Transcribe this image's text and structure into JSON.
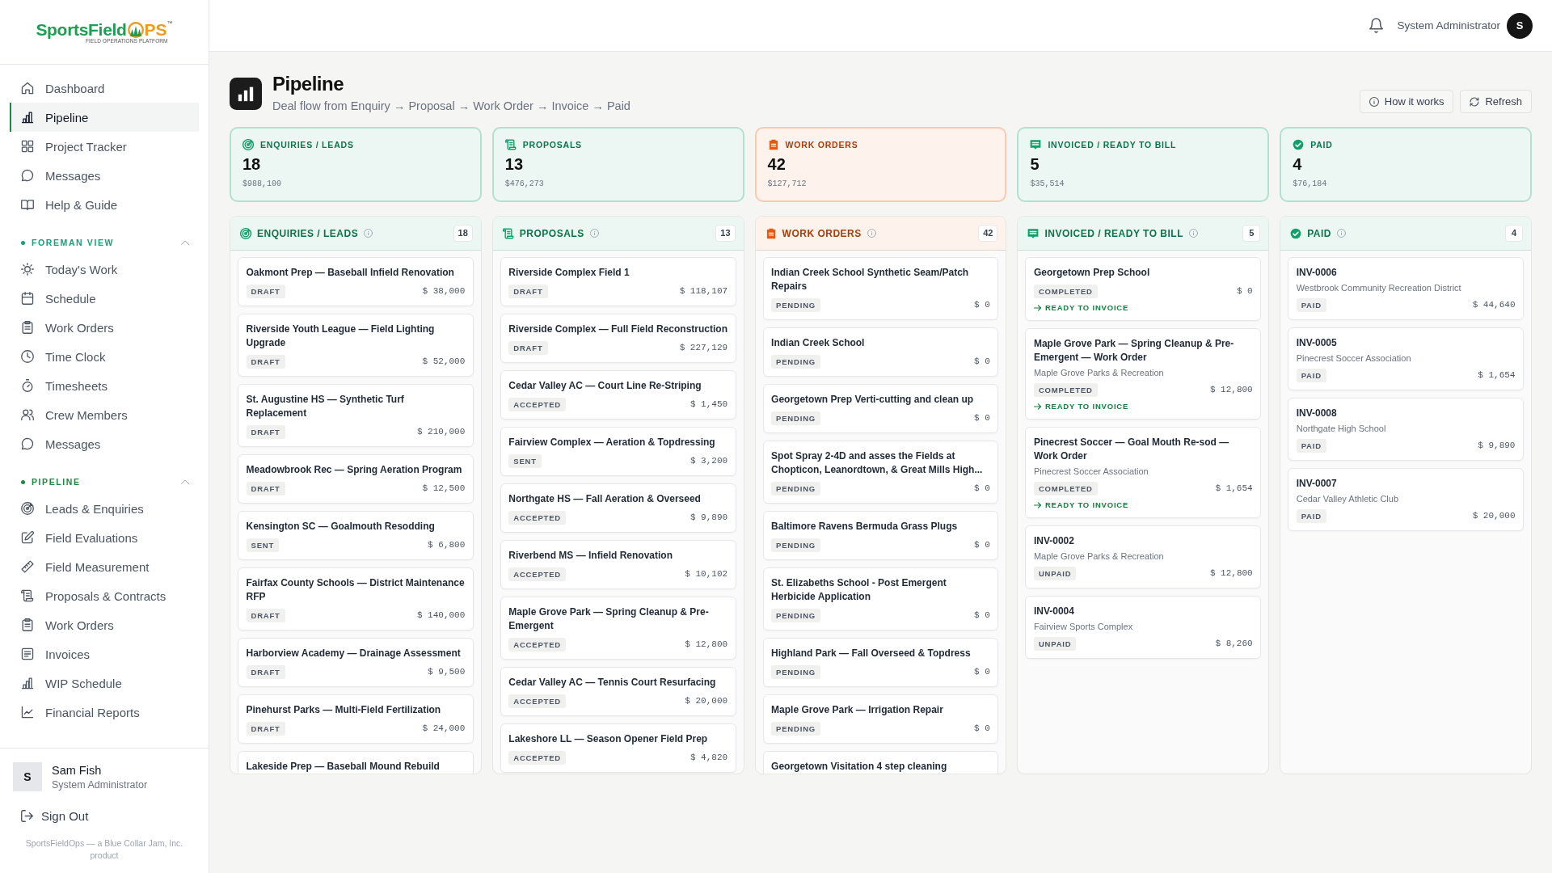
{
  "sidebar": {
    "logo": {
      "wordmark_start": "SportsField",
      "wordmark_end": "PS",
      "trademark": "™",
      "tagline": "FIELD OPERATIONS PLATFORM"
    },
    "nav": [
      {
        "label": "Dashboard",
        "selected": false
      },
      {
        "label": "Pipeline",
        "selected": true
      },
      {
        "label": "Project Tracker",
        "selected": false
      },
      {
        "label": "Messages",
        "selected": false
      },
      {
        "label": "Help & Guide",
        "selected": false
      }
    ],
    "sections": [
      {
        "title": "FOREMAN VIEW",
        "color": "#17a07b",
        "expanded": true,
        "items": [
          {
            "label": "Today's Work",
            "selected": false
          },
          {
            "label": "Schedule",
            "selected": false
          },
          {
            "label": "Work Orders",
            "selected": false
          },
          {
            "label": "Time Clock",
            "selected": false
          },
          {
            "label": "Timesheets",
            "selected": false
          },
          {
            "label": "Crew Members",
            "selected": false
          },
          {
            "label": "Messages",
            "selected": false
          }
        ]
      },
      {
        "title": "PIPELINE",
        "color": "#1b8a3e",
        "expanded": true,
        "items": [
          {
            "label": "Leads & Enquiries",
            "selected": false
          },
          {
            "label": "Field Evaluations",
            "selected": false
          },
          {
            "label": "Field Measurement",
            "selected": false
          },
          {
            "label": "Proposals & Contracts",
            "selected": false
          },
          {
            "label": "Work Orders",
            "selected": false
          },
          {
            "label": "Invoices",
            "selected": false
          },
          {
            "label": "WIP Schedule",
            "selected": false
          },
          {
            "label": "Financial Reports",
            "selected": false
          }
        ]
      }
    ],
    "user": {
      "initial": "S",
      "name": "Sam Fish",
      "role": "System Administrator"
    },
    "sign_out": "Sign Out",
    "footer": "SportsFieldOps — a Blue Collar Jam, Inc. product"
  },
  "header": {
    "user_role": "System Administrator",
    "avatar_initial": "S"
  },
  "page": {
    "title": "Pipeline",
    "subtitle": "Deal flow from Enquiry → Proposal → Work Order → Invoice → Paid",
    "buttons": [
      "How it works",
      "Refresh"
    ]
  },
  "summary": [
    {
      "label": "ENQUIRIES / LEADS",
      "color": "#12a06a",
      "count": "18",
      "amount": "$988,100"
    },
    {
      "label": "PROPOSALS",
      "color": "#12a06a",
      "count": "13",
      "amount": "$476,273"
    },
    {
      "label": "WORK ORDERS",
      "color": "#ea580c",
      "count": "42",
      "amount": "$127,712"
    },
    {
      "label": "INVOICED / READY TO BILL",
      "color": "#12a06a",
      "count": "5",
      "amount": "$35,514"
    },
    {
      "label": "PAID",
      "color": "#12a06a",
      "count": "4",
      "amount": "$76,184"
    }
  ],
  "columns": [
    {
      "title": "ENQUIRIES / LEADS",
      "color": "#12a06a",
      "count": "18",
      "cards": [
        {
          "title": "Oakmont Prep — Baseball Infield Renovation",
          "status": "DRAFT",
          "amount": "$ 38,000"
        },
        {
          "title": "Riverside Youth League — Field Lighting Upgrade",
          "status": "DRAFT",
          "amount": "$ 52,000"
        },
        {
          "title": "St. Augustine HS — Synthetic Turf Replacement",
          "status": "DRAFT",
          "amount": "$ 210,000"
        },
        {
          "title": "Meadowbrook Rec — Spring Aeration Program",
          "status": "DRAFT",
          "amount": "$ 12,500"
        },
        {
          "title": "Kensington SC — Goalmouth Resodding",
          "status": "SENT",
          "amount": "$ 6,800"
        },
        {
          "title": "Fairfax County Schools — District Maintenance RFP",
          "status": "DRAFT",
          "amount": "$ 140,000"
        },
        {
          "title": "Harborview Academy — Drainage Assessment",
          "status": "DRAFT",
          "amount": "$ 9,500"
        },
        {
          "title": "Pinehurst Parks — Multi-Field Fertilization",
          "status": "DRAFT",
          "amount": "$ 24,000"
        },
        {
          "title": "Lakeside Prep — Baseball Mound Rebuild"
        }
      ]
    },
    {
      "title": "PROPOSALS",
      "color": "#12a06a",
      "count": "13",
      "cards": [
        {
          "title": "Riverside Complex Field 1",
          "status": "DRAFT",
          "amount": "$ 118,107"
        },
        {
          "title": "Riverside Complex — Full Field Reconstruction",
          "status": "DRAFT",
          "amount": "$ 227,129"
        },
        {
          "title": "Cedar Valley AC — Court Line Re-Striping",
          "status": "ACCEPTED",
          "amount": "$ 1,450"
        },
        {
          "title": "Fairview Complex — Aeration & Topdressing",
          "status": "SENT",
          "amount": "$ 3,200"
        },
        {
          "title": "Northgate HS — Fall Aeration & Overseed",
          "status": "ACCEPTED",
          "amount": "$ 9,890"
        },
        {
          "title": "Riverbend MS — Infield Renovation",
          "status": "ACCEPTED",
          "amount": "$ 10,102"
        },
        {
          "title": "Maple Grove Park — Spring Cleanup & Pre-Emergent",
          "status": "ACCEPTED",
          "amount": "$ 12,800"
        },
        {
          "title": "Cedar Valley AC — Tennis Court Resurfacing",
          "status": "ACCEPTED",
          "amount": "$ 20,000"
        },
        {
          "title": "Lakeshore LL — Season Opener Field Prep",
          "status": "ACCEPTED",
          "amount": "$ 4,820"
        }
      ]
    },
    {
      "title": "WORK ORDERS",
      "color": "#ea580c",
      "count": "42",
      "cards": [
        {
          "title": "Indian Creek School Synthetic Seam/Patch Repairs",
          "status": "PENDING",
          "amount": "$ 0"
        },
        {
          "title": "Indian Creek School",
          "status": "PENDING",
          "amount": "$ 0"
        },
        {
          "title": "Georgetown Prep Verti-cutting and clean up",
          "status": "PENDING",
          "amount": "$ 0"
        },
        {
          "title": "Spot Spray 2-4D and asses the Fields at Chopticon, Leanordtown, & Great Mills High...",
          "status": "PENDING",
          "amount": "$ 0"
        },
        {
          "title": "Baltimore Ravens Bermuda Grass Plugs",
          "status": "PENDING",
          "amount": "$ 0"
        },
        {
          "title": "St. Elizabeths School - Post Emergent Herbicide Application",
          "status": "PENDING",
          "amount": "$ 0"
        },
        {
          "title": "Highland Park — Fall Overseed & Topdress",
          "status": "PENDING",
          "amount": "$ 0"
        },
        {
          "title": "Maple Grove Park — Irrigation Repair",
          "status": "PENDING",
          "amount": "$ 0"
        },
        {
          "title": "Georgetown Visitation 4 step cleaning"
        }
      ]
    },
    {
      "title": "INVOICED / READY TO BILL",
      "color": "#12a06a",
      "count": "5",
      "cards": [
        {
          "title": "Georgetown Prep School",
          "status": "COMPLETED",
          "amount": "$ 0",
          "action": "READY TO INVOICE"
        },
        {
          "title": "Maple Grove Park — Spring Cleanup & Pre-Emergent — Work Order",
          "client": "Maple Grove Parks & Recreation",
          "status": "COMPLETED",
          "amount": "$ 12,800",
          "action": "READY TO INVOICE"
        },
        {
          "title": "Pinecrest Soccer — Goal Mouth Re-sod — Work Order",
          "client": "Pinecrest Soccer Association",
          "status": "COMPLETED",
          "amount": "$ 1,654",
          "action": "READY TO INVOICE"
        },
        {
          "title": "INV-0002",
          "client": "Maple Grove Parks & Recreation",
          "status": "UNPAID",
          "amount": "$ 12,800"
        },
        {
          "title": "INV-0004",
          "client": "Fairview Sports Complex",
          "status": "UNPAID",
          "amount": "$ 8,260"
        }
      ]
    },
    {
      "title": "PAID",
      "color": "#12a06a",
      "count": "4",
      "cards": [
        {
          "title": "INV-0006",
          "client": "Westbrook Community Recreation District",
          "status": "PAID",
          "amount": "$ 44,640"
        },
        {
          "title": "INV-0005",
          "client": "Pinecrest Soccer Association",
          "status": "PAID",
          "amount": "$ 1,654"
        },
        {
          "title": "INV-0008",
          "client": "Northgate High School",
          "status": "PAID",
          "amount": "$ 9,890"
        },
        {
          "title": "INV-0007",
          "client": "Cedar Valley Athletic Club",
          "status": "PAID",
          "amount": "$ 20,000"
        }
      ]
    }
  ]
}
